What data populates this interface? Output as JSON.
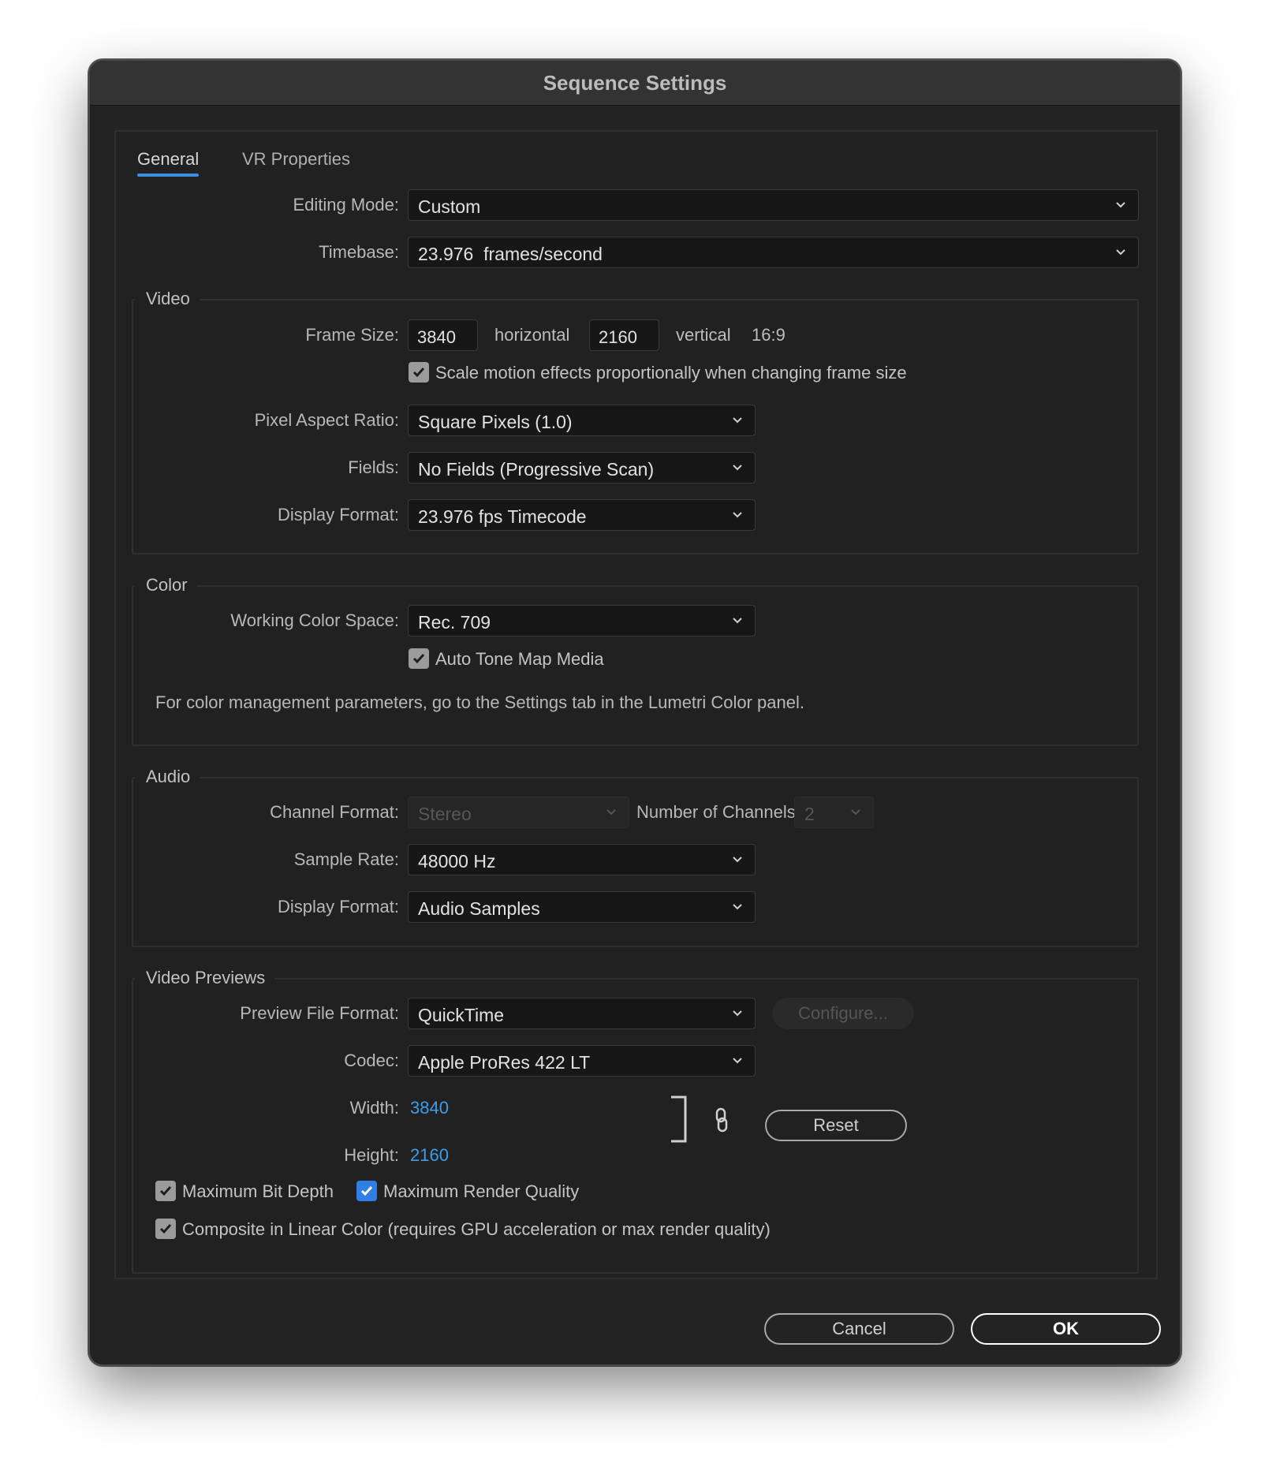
{
  "dialog": {
    "title": "Sequence Settings"
  },
  "tabs": [
    {
      "label": "General",
      "active": true
    },
    {
      "label": "VR Properties",
      "active": false
    }
  ],
  "general": {
    "editing_mode": {
      "label": "Editing Mode:",
      "value": "Custom"
    },
    "timebase": {
      "label": "Timebase:",
      "value": "23.976  frames/second"
    }
  },
  "video": {
    "title": "Video",
    "frame_size": {
      "label": "Frame Size:",
      "horizontal_value": "3840",
      "horizontal_label": "horizontal",
      "vertical_value": "2160",
      "vertical_label": "vertical",
      "aspect": "16:9"
    },
    "scale_motion": {
      "label": "Scale motion effects proportionally when changing frame size",
      "checked": true
    },
    "pixel_aspect_ratio": {
      "label": "Pixel Aspect Ratio:",
      "value": "Square Pixels (1.0)"
    },
    "fields": {
      "label": "Fields:",
      "value": "No Fields (Progressive Scan)"
    },
    "display_format": {
      "label": "Display Format:",
      "value": "23.976 fps Timecode"
    }
  },
  "color": {
    "title": "Color",
    "working_color_space": {
      "label": "Working Color Space:",
      "value": "Rec. 709"
    },
    "auto_tone_map": {
      "label": "Auto Tone Map Media",
      "checked": true
    },
    "note": "For color management parameters, go to the Settings tab in the Lumetri Color panel."
  },
  "audio": {
    "title": "Audio",
    "channel_format": {
      "label": "Channel Format:",
      "value": "Stereo",
      "disabled": true
    },
    "number_of_channels": {
      "label": "Number of Channels:",
      "value": "2",
      "disabled": true
    },
    "sample_rate": {
      "label": "Sample Rate:",
      "value": "48000 Hz"
    },
    "display_format": {
      "label": "Display Format:",
      "value": "Audio Samples"
    }
  },
  "video_previews": {
    "title": "Video Previews",
    "preview_file_format": {
      "label": "Preview File Format:",
      "value": "QuickTime"
    },
    "configure_label": "Configure...",
    "codec": {
      "label": "Codec:",
      "value": "Apple ProRes 422 LT"
    },
    "width": {
      "label": "Width:",
      "value": "3840"
    },
    "height": {
      "label": "Height:",
      "value": "2160"
    },
    "reset_label": "Reset",
    "max_bit_depth": {
      "label": "Maximum Bit Depth",
      "checked": true
    },
    "max_render_quality": {
      "label": "Maximum Render Quality",
      "checked": true
    },
    "composite_linear": {
      "label": "Composite in Linear Color (requires GPU acceleration or max render quality)",
      "checked": true
    }
  },
  "footer": {
    "cancel_label": "Cancel",
    "ok_label": "OK"
  },
  "colors": {
    "accent": "#3b8ee0",
    "link_value": "#3f9ce8",
    "background": "#232323"
  }
}
